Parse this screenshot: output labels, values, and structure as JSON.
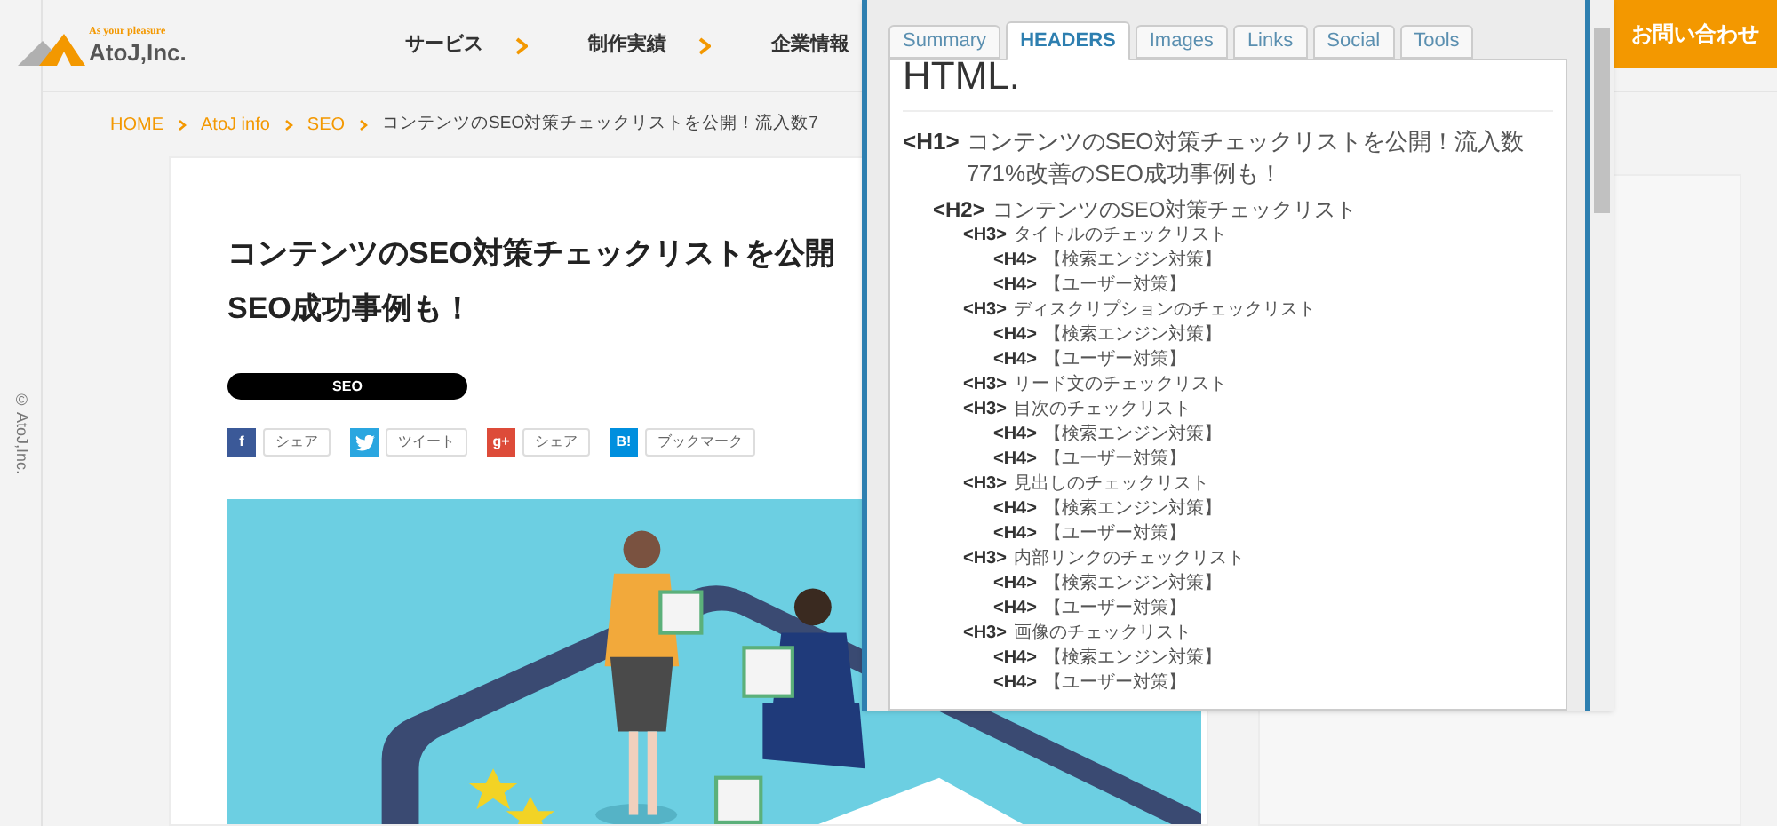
{
  "sidebar": {
    "copyright": "© AtoJ,Inc."
  },
  "header": {
    "logo": {
      "tagline": "As your pleasure",
      "name": "AtoJ,Inc."
    },
    "nav": [
      {
        "label": "サービス"
      },
      {
        "label": "制作実績"
      },
      {
        "label": "企業情報"
      }
    ],
    "contact_button": "お問い合わせ"
  },
  "breadcrumb": [
    {
      "label": "HOME",
      "link": true
    },
    {
      "label": "AtoJ info",
      "link": true
    },
    {
      "label": "SEO",
      "link": true
    },
    {
      "label": "コンテンツのSEO対策チェックリストを公開！流入数7",
      "link": false
    }
  ],
  "article": {
    "title_lines": [
      "コンテンツのSEO対策チェックリストを公開",
      "SEO成功事例も！"
    ],
    "tag": "SEO",
    "share": [
      {
        "kind": "facebook",
        "glyph": "f",
        "label": "シェア"
      },
      {
        "kind": "twitter",
        "label": "ツイート"
      },
      {
        "kind": "google",
        "glyph": "g+",
        "label": "シェア"
      },
      {
        "kind": "hatena",
        "glyph": "B!",
        "label": "ブックマーク"
      }
    ],
    "image": {
      "kind": "picture"
    }
  },
  "popup": {
    "tabs": [
      {
        "label": "Summary",
        "selected": false
      },
      {
        "label": "HEADERS",
        "selected": true
      },
      {
        "label": "Images",
        "selected": false
      },
      {
        "label": "Links",
        "selected": false
      },
      {
        "label": "Social",
        "selected": false
      },
      {
        "label": "Tools",
        "selected": false
      }
    ],
    "heading": "HTML.",
    "headers": [
      {
        "tag": "<H1>",
        "text": "コンテンツのSEO対策チェックリストを公開！流入数771%改善のSEO成功事例も！",
        "children": [
          {
            "tag": "<H2>",
            "text": "コンテンツのSEO対策チェックリスト",
            "children": [
              {
                "tag": "<H3>",
                "text": "タイトルのチェックリスト",
                "children": [
                  {
                    "tag": "<H4>",
                    "text": "【検索エンジン対策】"
                  },
                  {
                    "tag": "<H4>",
                    "text": "【ユーザー対策】"
                  }
                ]
              },
              {
                "tag": "<H3>",
                "text": "ディスクリプションのチェックリスト",
                "children": [
                  {
                    "tag": "<H4>",
                    "text": "【検索エンジン対策】"
                  },
                  {
                    "tag": "<H4>",
                    "text": "【ユーザー対策】"
                  }
                ]
              },
              {
                "tag": "<H3>",
                "text": "リード文のチェックリスト"
              },
              {
                "tag": "<H3>",
                "text": "目次のチェックリスト",
                "children": [
                  {
                    "tag": "<H4>",
                    "text": "【検索エンジン対策】"
                  },
                  {
                    "tag": "<H4>",
                    "text": "【ユーザー対策】"
                  }
                ]
              },
              {
                "tag": "<H3>",
                "text": "見出しのチェックリスト",
                "children": [
                  {
                    "tag": "<H4>",
                    "text": "【検索エンジン対策】"
                  },
                  {
                    "tag": "<H4>",
                    "text": "【ユーザー対策】"
                  }
                ]
              },
              {
                "tag": "<H3>",
                "text": "内部リンクのチェックリスト",
                "children": [
                  {
                    "tag": "<H4>",
                    "text": "【検索エンジン対策】"
                  },
                  {
                    "tag": "<H4>",
                    "text": "【ユーザー対策】"
                  }
                ]
              },
              {
                "tag": "<H3>",
                "text": "画像のチェックリスト",
                "children": [
                  {
                    "tag": "<H4>",
                    "text": "【検索エンジン対策】"
                  },
                  {
                    "tag": "<H4>",
                    "text": "【ユーザー対策】"
                  }
                ]
              }
            ]
          }
        ]
      }
    ]
  }
}
